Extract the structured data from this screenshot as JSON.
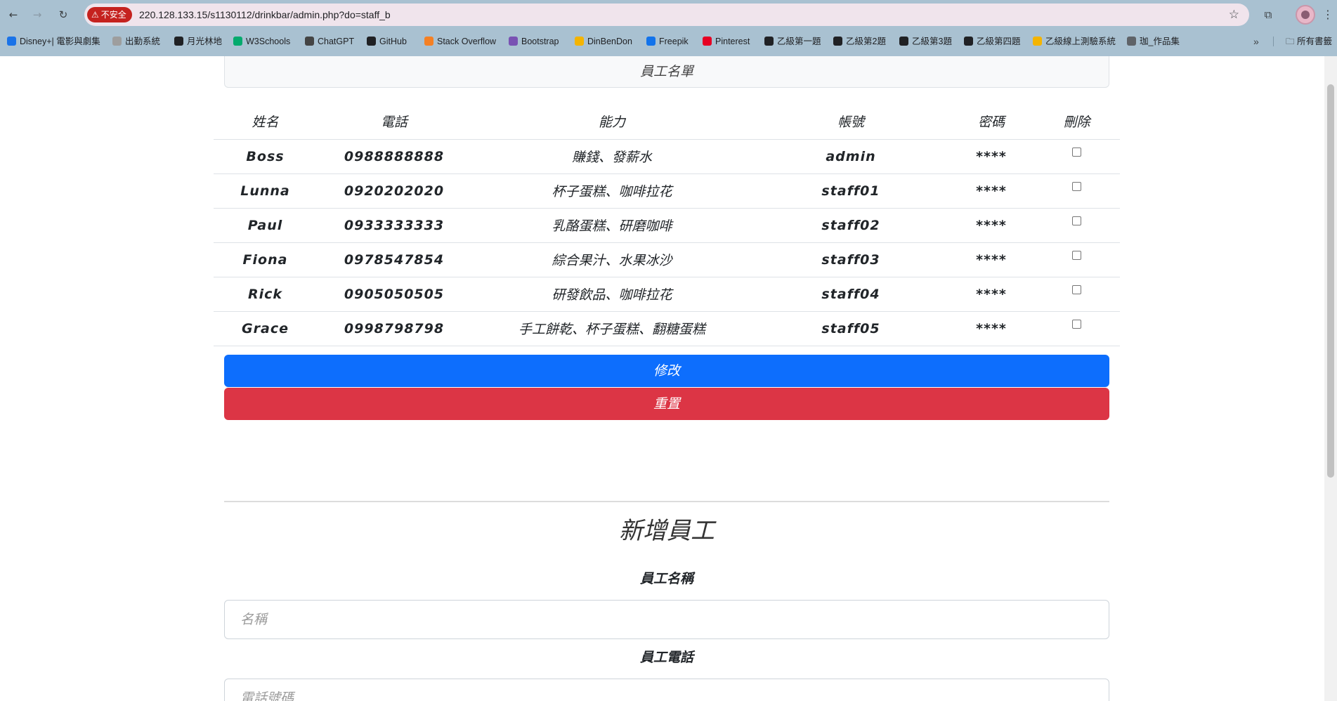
{
  "browser": {
    "security_label": "不安全",
    "url": "220.128.133.15/s1130112/drinkbar/admin.php?do=staff_b",
    "bookmarks": [
      {
        "label": "Disney+| 電影與劇集",
        "color": "#1a73e8"
      },
      {
        "label": "出勤系統",
        "color": "#9e9e9e"
      },
      {
        "label": "月光林地",
        "color": "#202124"
      },
      {
        "label": "W3Schools",
        "color": "#04aa6d"
      },
      {
        "label": "ChatGPT",
        "color": "#444444"
      },
      {
        "label": "GitHub",
        "color": "#202124"
      },
      {
        "label": "Stack Overflow",
        "color": "#f48024"
      },
      {
        "label": "Bootstrap",
        "color": "#7952b3"
      },
      {
        "label": "DinBenDon",
        "color": "#f4b400"
      },
      {
        "label": "Freepik",
        "color": "#1273eb"
      },
      {
        "label": "Pinterest",
        "color": "#e60023"
      },
      {
        "label": "乙級第一題",
        "color": "#202124"
      },
      {
        "label": "乙級第2題",
        "color": "#202124"
      },
      {
        "label": "乙級第3題",
        "color": "#202124"
      },
      {
        "label": "乙級第四題",
        "color": "#202124"
      },
      {
        "label": "乙級線上測驗系統",
        "color": "#f4b400"
      },
      {
        "label": "珈_作品集",
        "color": "#5f6368"
      }
    ],
    "all_bookmarks_label": "所有書籤"
  },
  "staff_list": {
    "title": "員工名單",
    "columns": [
      "姓名",
      "電話",
      "能力",
      "帳號",
      "密碼",
      "刪除"
    ],
    "rows": [
      {
        "name": "Boss",
        "phone": "0988888888",
        "skill": "賺錢、發薪水",
        "account": "admin",
        "password": "****",
        "delete": false
      },
      {
        "name": "Lunna",
        "phone": "0920202020",
        "skill": "杯子蛋糕、咖啡拉花",
        "account": "staff01",
        "password": "****",
        "delete": false
      },
      {
        "name": "Paul",
        "phone": "0933333333",
        "skill": "乳酪蛋糕、研磨咖啡",
        "account": "staff02",
        "password": "****",
        "delete": false
      },
      {
        "name": "Fiona",
        "phone": "0978547854",
        "skill": "綜合果汁、水果冰沙",
        "account": "staff03",
        "password": "****",
        "delete": false
      },
      {
        "name": "Rick",
        "phone": "0905050505",
        "skill": "研發飲品、咖啡拉花",
        "account": "staff04",
        "password": "****",
        "delete": false
      },
      {
        "name": "Grace",
        "phone": "0998798798",
        "skill": "手工餅乾、杯子蛋糕、翻糖蛋糕",
        "account": "staff05",
        "password": "****",
        "delete": false
      }
    ],
    "edit_button": "修改",
    "reset_button": "重置"
  },
  "add_staff": {
    "title": "新增員工",
    "name_label": "員工名稱",
    "name_placeholder": "名稱",
    "phone_label": "員工電話",
    "phone_placeholder": "電話號碼"
  }
}
